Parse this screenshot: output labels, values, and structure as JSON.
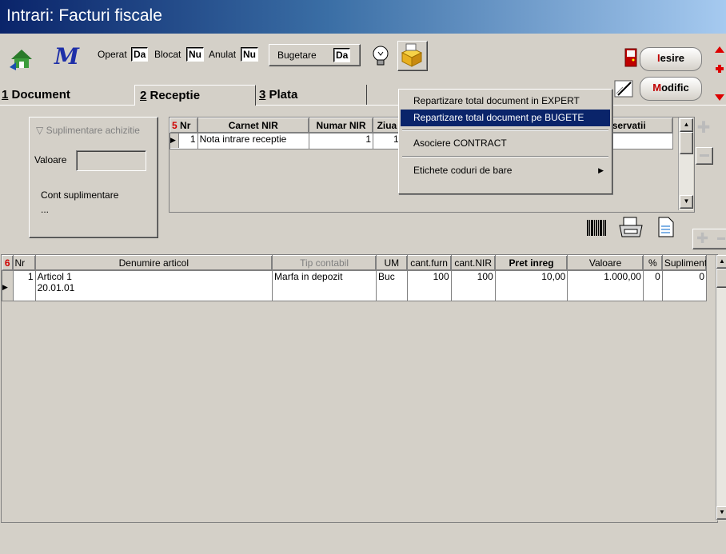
{
  "window": {
    "title": "Intrari: Facturi fiscale"
  },
  "toolbar": {
    "operat_label": "Operat",
    "operat_value": "Da",
    "blocat_label": "Blocat",
    "blocat_value": "Nu",
    "anulat_label": "Anulat",
    "anulat_value": "Nu",
    "bugetare_label": "Bugetare",
    "bugetare_value": "Da",
    "iesire_hot": "I",
    "iesire_rest": "esire",
    "modific_hot": "M",
    "modific_rest": "odific"
  },
  "tabs": [
    {
      "key": "1",
      "label": " Document"
    },
    {
      "key": "2",
      "label": " Receptie"
    },
    {
      "key": "3",
      "label": " Plata"
    }
  ],
  "left_panel": {
    "suplimentare_label": "Suplimentare achizitie",
    "valoare_label": "Valoare",
    "valoare_value": "",
    "cont_label": "Cont suplimentare",
    "cont_value": "..."
  },
  "nir_grid": {
    "number": "5",
    "columns": [
      "Nr",
      "Carnet NIR",
      "Numar NIR",
      "Ziua",
      "Observatii"
    ],
    "rows": [
      {
        "nr": "1",
        "carnet": "Nota intrare receptie",
        "numar": "1",
        "ziua": "1"
      }
    ]
  },
  "context_menu": {
    "items": [
      "Repartizare total document in EXPERT",
      "Repartizare total document pe BUGETE",
      "Asociere CONTRACT",
      "Etichete coduri de bare"
    ],
    "selected_index": 1
  },
  "articles_grid": {
    "number": "6",
    "columns": [
      "Nr",
      "Denumire articol",
      "Tip contabil",
      "UM",
      "cant.furn",
      "cant.NIR",
      "Pret inreg",
      "Valoare",
      "%",
      "Suplimente"
    ],
    "rows": [
      {
        "nr": "1",
        "denumire": "Articol 1",
        "cod": "20.01.01",
        "tip": "Marfa in depozit",
        "um": "Buc",
        "cant_furn": "100",
        "cant_nir": "100",
        "pret": "10,00",
        "valoare": "1.000,00",
        "pct": "0",
        "supl": "0"
      }
    ]
  }
}
